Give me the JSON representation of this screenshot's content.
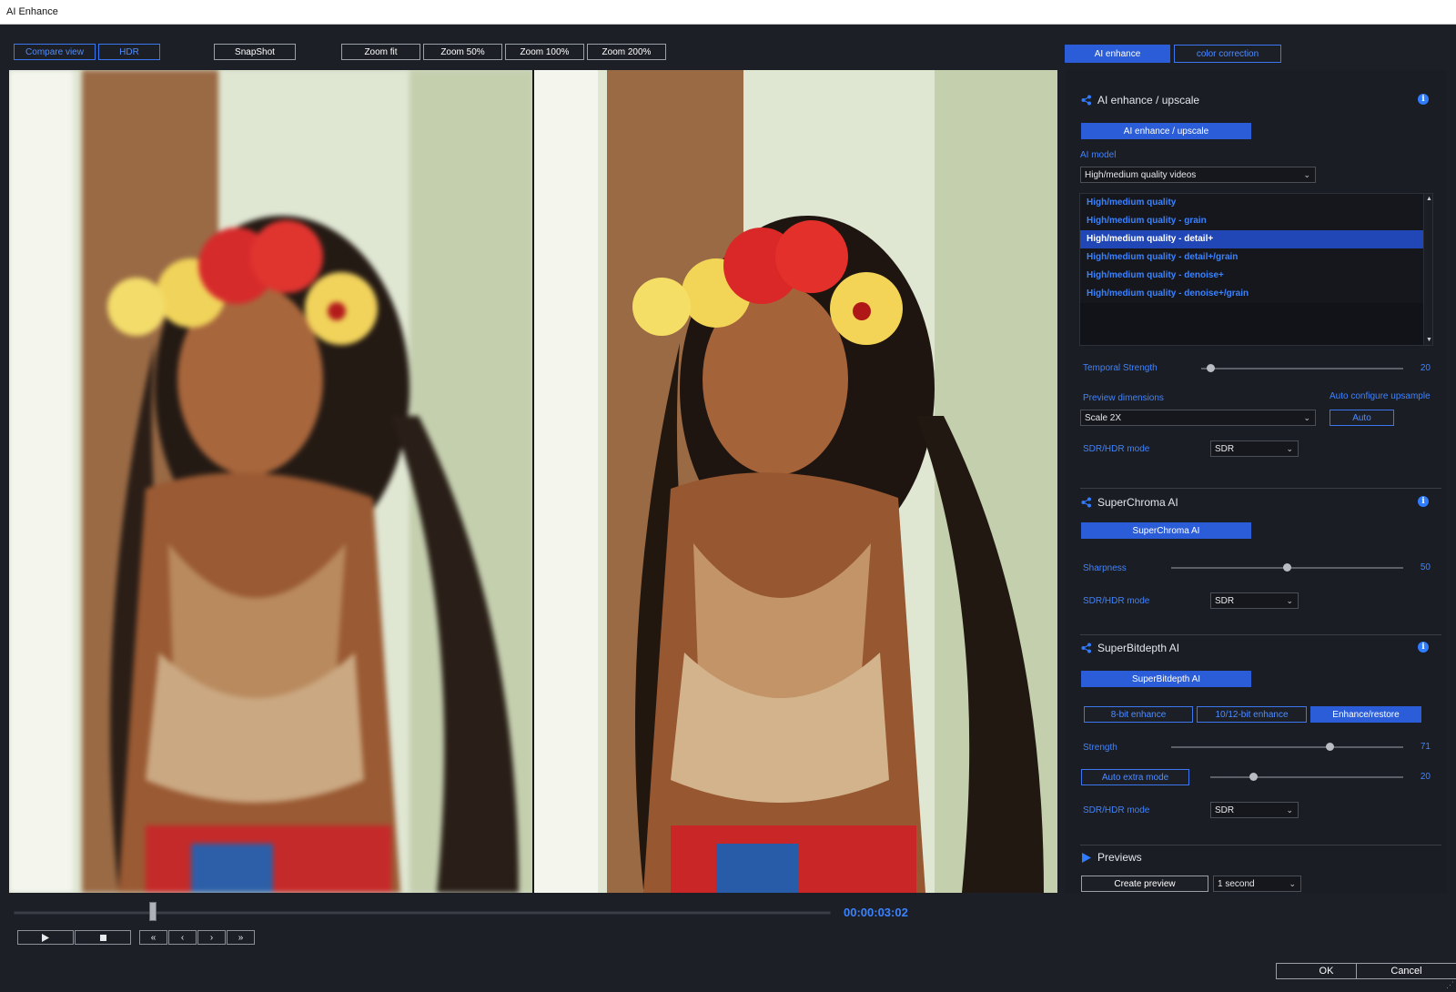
{
  "window": {
    "title": "AI Enhance"
  },
  "toolbar": {
    "compare_view": "Compare view",
    "hdr": "HDR",
    "snapshot": "SnapShot",
    "zoom_fit": "Zoom fit",
    "zoom_50": "Zoom 50%",
    "zoom_100": "Zoom 100%",
    "zoom_200": "Zoom 200%"
  },
  "panel_tabs": {
    "ai_enhance": "AI enhance",
    "color_correction": "color correction"
  },
  "ai_enhance": {
    "title": "AI enhance / upscale",
    "toggle_label": "AI enhance / upscale",
    "ai_model_label": "AI model",
    "ai_model_value": "High/medium quality videos",
    "models": [
      "High/medium quality",
      "High/medium quality - grain",
      "High/medium quality - detail+",
      "High/medium quality - detail+/grain",
      "High/medium quality - denoise+",
      "High/medium quality - denoise+/grain"
    ],
    "selected_model": "High/medium quality - detail+",
    "temporal_strength_label": "Temporal Strength",
    "temporal_strength_value": "20",
    "temporal_strength_level": 0.03,
    "preview_dimensions_label": "Preview dimensions",
    "auto_configure_label": "Auto configure upsample",
    "preview_dimensions_value": "Scale 2X",
    "auto_button": "Auto",
    "sdr_hdr_label": "SDR/HDR mode",
    "sdr_hdr_value": "SDR"
  },
  "superchroma": {
    "title": "SuperChroma AI",
    "toggle_label": "SuperChroma AI",
    "sharpness_label": "Sharpness",
    "sharpness_value": "50",
    "sharpness_level": 0.5,
    "sdr_hdr_label": "SDR/HDR mode",
    "sdr_hdr_value": "SDR"
  },
  "superbitdepth": {
    "title": "SuperBitdepth AI",
    "toggle_label": "SuperBitdepth AI",
    "mode_8bit": "8-bit enhance",
    "mode_1012bit": "10/12-bit enhance",
    "mode_restore": "Enhance/restore",
    "strength_label": "Strength",
    "strength_value": "71",
    "strength_level": 0.69,
    "auto_extra_mode": "Auto extra mode",
    "extra_value": "20",
    "extra_level": 0.21,
    "sdr_hdr_label": "SDR/HDR mode",
    "sdr_hdr_value": "SDR"
  },
  "previews": {
    "title": "Previews",
    "create_preview": "Create preview",
    "duration_value": "1 second"
  },
  "playback": {
    "timecode": "00:00:03:02",
    "position": 0.17,
    "play_icon": "play-icon",
    "stop_icon": "stop-icon",
    "first_label": "«",
    "prev_label": "‹",
    "next_label": "›",
    "last_label": "»"
  },
  "dialog": {
    "ok": "OK",
    "cancel": "Cancel"
  },
  "colors": {
    "accent": "#2b5dd8",
    "accent_text": "#3b82ff",
    "background": "#1c1f26"
  }
}
